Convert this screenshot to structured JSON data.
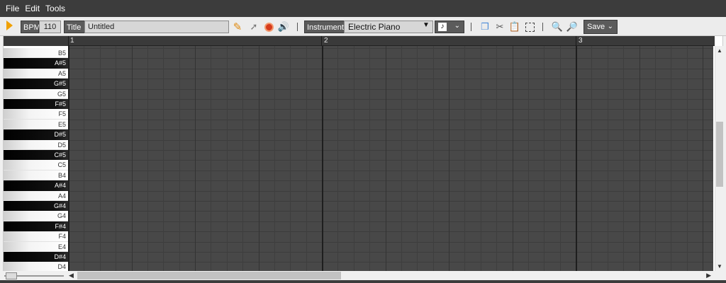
{
  "menu": [
    "File",
    "Edit",
    "Tools"
  ],
  "toolbar": {
    "bpm_label": "BPM",
    "bpm_value": "110",
    "title_label": "Title",
    "title_value": "Untitled",
    "instrument_label": "Instrument",
    "instrument_value": "Electric Piano",
    "save_label": "Save",
    "tool_icons": [
      "play-icon",
      "pencil-icon",
      "pointer-icon",
      "record-icon",
      "speaker-icon",
      "copy-icon",
      "cut-icon",
      "paste-icon",
      "select-all-icon",
      "zoom-in-icon",
      "zoom-out-icon"
    ]
  },
  "ruler": {
    "bars": [
      "1",
      "2",
      "3"
    ]
  },
  "keys": [
    {
      "label": "B5",
      "color": "white"
    },
    {
      "label": "A#5",
      "color": "black"
    },
    {
      "label": "A5",
      "color": "white"
    },
    {
      "label": "G#5",
      "color": "black"
    },
    {
      "label": "G5",
      "color": "white"
    },
    {
      "label": "F#5",
      "color": "black"
    },
    {
      "label": "F5",
      "color": "white"
    },
    {
      "label": "E5",
      "color": "white"
    },
    {
      "label": "D#5",
      "color": "black"
    },
    {
      "label": "D5",
      "color": "white"
    },
    {
      "label": "C#5",
      "color": "black"
    },
    {
      "label": "C5",
      "color": "white"
    },
    {
      "label": "B4",
      "color": "white"
    },
    {
      "label": "A#4",
      "color": "black"
    },
    {
      "label": "A4",
      "color": "white"
    },
    {
      "label": "G#4",
      "color": "black"
    },
    {
      "label": "G4",
      "color": "white"
    },
    {
      "label": "F#4",
      "color": "black"
    },
    {
      "label": "F4",
      "color": "white"
    },
    {
      "label": "E4",
      "color": "white"
    },
    {
      "label": "D#4",
      "color": "black"
    },
    {
      "label": "D4",
      "color": "white"
    }
  ],
  "colors": {
    "grid_bg": "#484848",
    "accent_play": "#f0a000",
    "toolbar_tag": "#5b5b5b"
  }
}
